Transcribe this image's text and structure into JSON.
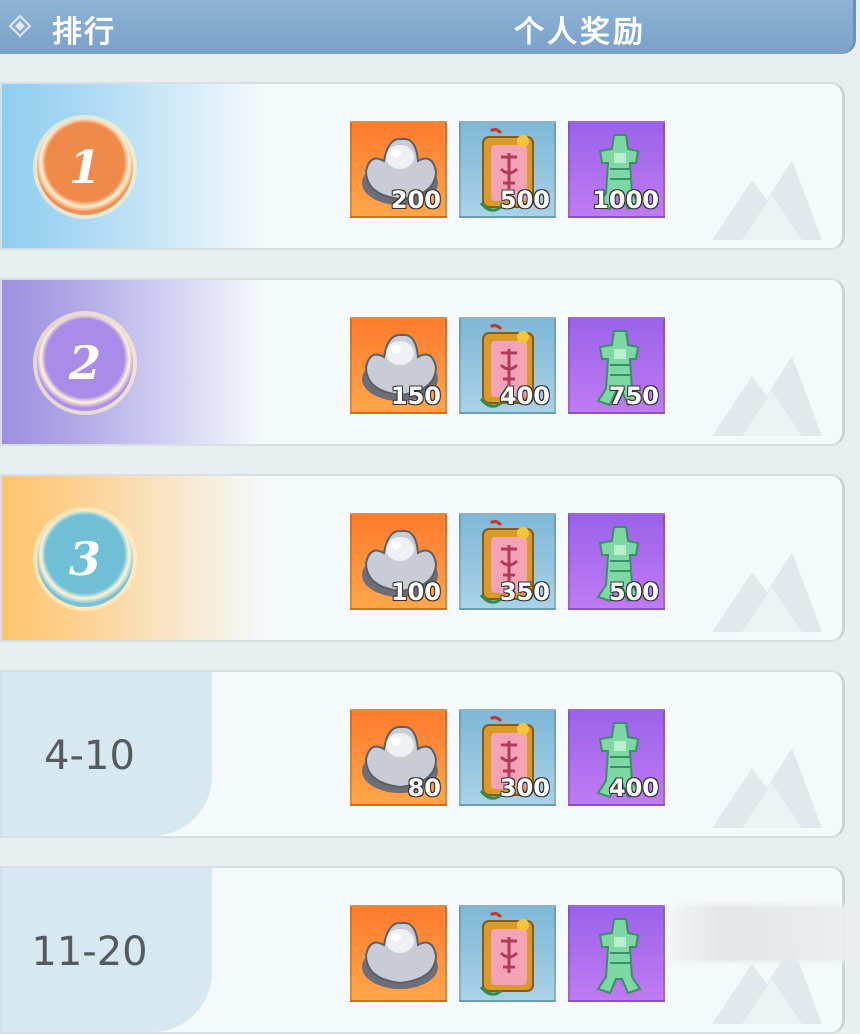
{
  "header": {
    "rank_label": "排行",
    "reward_label": "个人奖励",
    "icon": "diamond-icon"
  },
  "rows": [
    {
      "rank": "1",
      "style": "medal",
      "medal_color": "#f08a4b",
      "bg_color": "#8fcef0",
      "rewards": [
        {
          "icon": "silver-ingot-icon",
          "qty": "200"
        },
        {
          "icon": "charm-icon",
          "qty": "500"
        },
        {
          "icon": "jade-coin-icon",
          "qty": "1000"
        }
      ]
    },
    {
      "rank": "2",
      "style": "medal",
      "medal_color": "#a98be8",
      "bg_color": "#9c8fe0",
      "rewards": [
        {
          "icon": "silver-ingot-icon",
          "qty": "150"
        },
        {
          "icon": "charm-icon",
          "qty": "400"
        },
        {
          "icon": "jade-coin-icon",
          "qty": "750"
        }
      ]
    },
    {
      "rank": "3",
      "style": "medal",
      "medal_color": "#6fc0d6",
      "bg_color": "#ffc46e",
      "rewards": [
        {
          "icon": "silver-ingot-icon",
          "qty": "100"
        },
        {
          "icon": "charm-icon",
          "qty": "350"
        },
        {
          "icon": "jade-coin-icon",
          "qty": "500"
        }
      ]
    },
    {
      "rank": "4-10",
      "style": "tab",
      "rewards": [
        {
          "icon": "silver-ingot-icon",
          "qty": "80"
        },
        {
          "icon": "charm-icon",
          "qty": "300"
        },
        {
          "icon": "jade-coin-icon",
          "qty": "400"
        }
      ]
    },
    {
      "rank": "11-20",
      "style": "tab",
      "rewards": [
        {
          "icon": "silver-ingot-icon",
          "qty": ""
        },
        {
          "icon": "charm-icon",
          "qty": ""
        },
        {
          "icon": "jade-coin-icon",
          "qty": ""
        }
      ]
    }
  ]
}
